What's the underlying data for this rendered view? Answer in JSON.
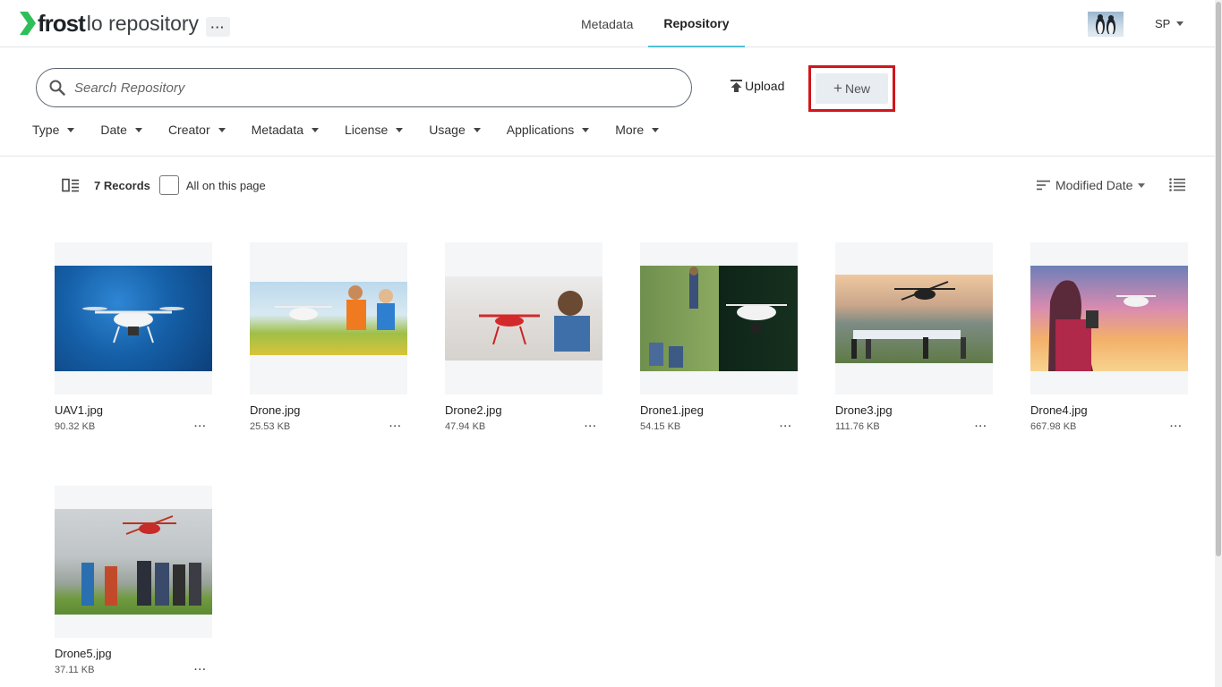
{
  "app": {
    "brand": "frost",
    "product": "lo repository",
    "menu_label": "···"
  },
  "nav": {
    "tabs": [
      {
        "label": "Metadata",
        "active": false
      },
      {
        "label": "Repository",
        "active": true
      }
    ]
  },
  "user": {
    "initials": "SP"
  },
  "search": {
    "placeholder": "Search Repository",
    "value": ""
  },
  "actions": {
    "upload_label": "Upload",
    "new_label": "New"
  },
  "filters": [
    "Type",
    "Date",
    "Creator",
    "Metadata",
    "License",
    "Usage",
    "Applications",
    "More"
  ],
  "records": {
    "count_label": "7 Records",
    "select_all_label": "All on this page",
    "sort_label": "Modified Date"
  },
  "files": [
    {
      "name": "UAV1.jpg",
      "size": "90.32 KB",
      "more": "···"
    },
    {
      "name": "Drone.jpg",
      "size": "25.53 KB",
      "more": "···"
    },
    {
      "name": "Drone2.jpg",
      "size": "47.94 KB",
      "more": "···"
    },
    {
      "name": "Drone1.jpeg",
      "size": "54.15 KB",
      "more": "···"
    },
    {
      "name": "Drone3.jpg",
      "size": "111.76 KB",
      "more": "···"
    },
    {
      "name": "Drone4.jpg",
      "size": "667.98 KB",
      "more": "···"
    },
    {
      "name": "Drone5.jpg",
      "size": "37.11 KB",
      "more": "···"
    }
  ],
  "colors": {
    "brand_green": "#2fbf5a",
    "active_tab_underline": "#4ec1d6",
    "highlight_red": "#d0161c",
    "new_button_bg": "#e8edf2"
  },
  "icons": {
    "search": "search-icon",
    "upload": "upload-icon",
    "panel": "panel-toggle-icon",
    "sort": "sort-icon",
    "list_view": "list-view-icon"
  }
}
